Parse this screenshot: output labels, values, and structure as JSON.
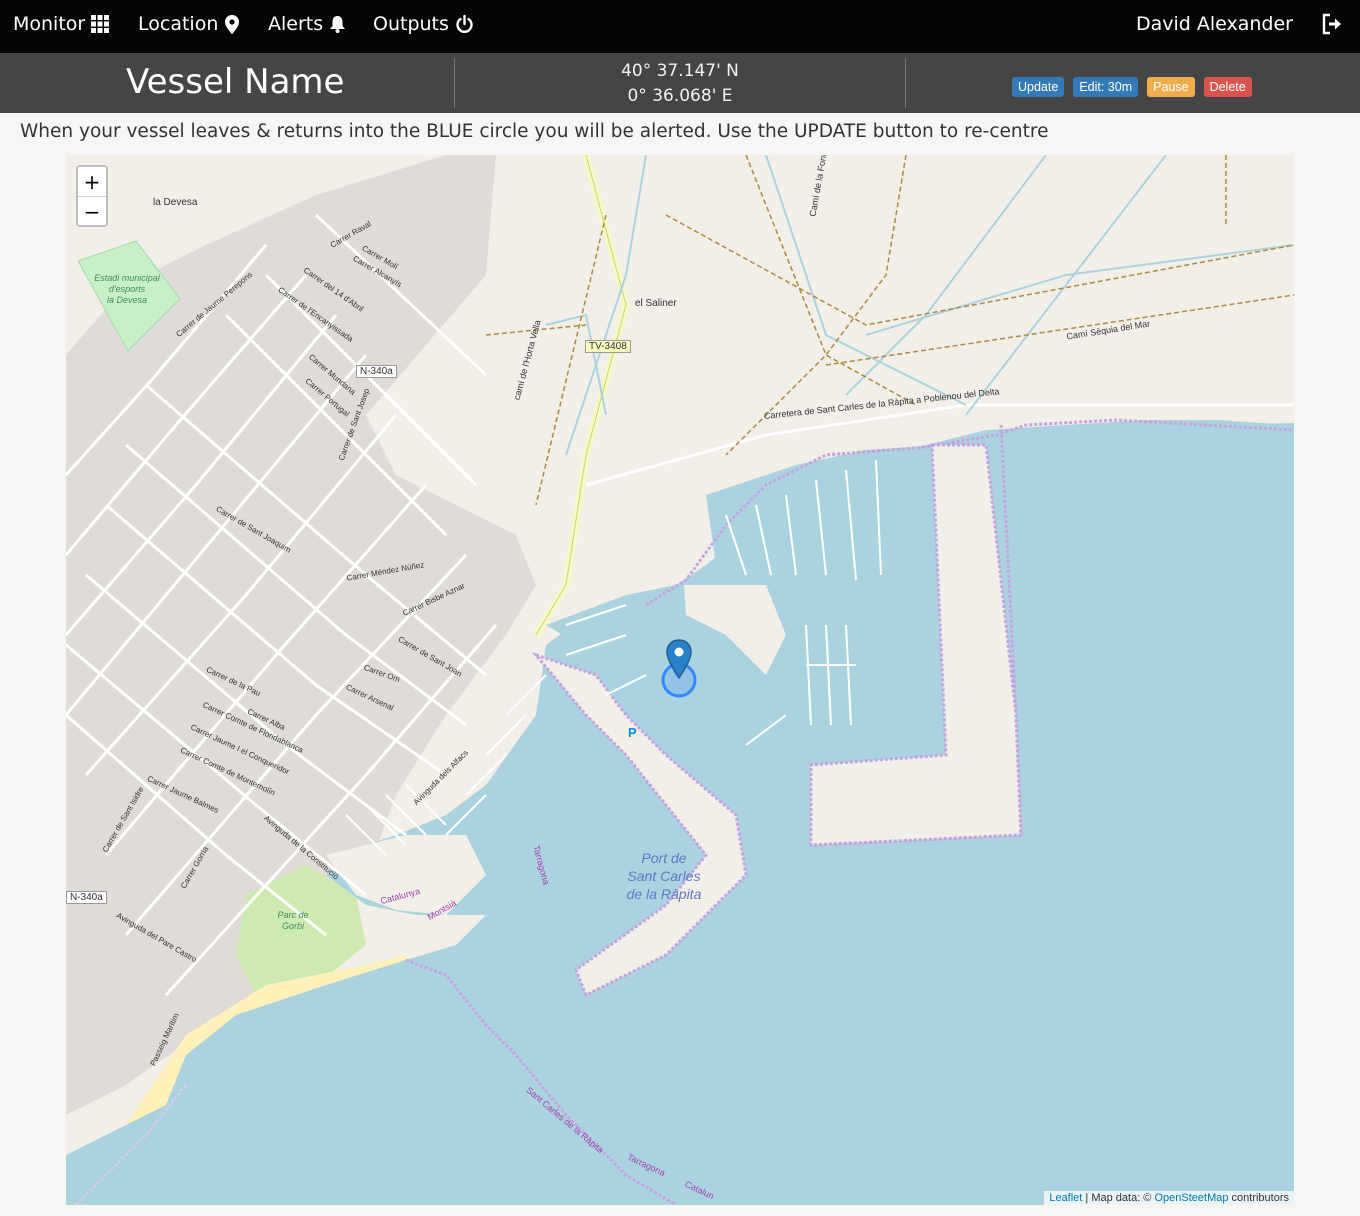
{
  "nav": {
    "monitor": "Monitor",
    "location": "Location",
    "alerts": "Alerts",
    "outputs": "Outputs",
    "user": "David Alexander",
    "logout_icon": "logout-icon"
  },
  "vessel": {
    "name": "Vessel Name",
    "lat": "40° 37.147' N",
    "lon": "0° 36.068' E"
  },
  "buttons": {
    "update": "Update",
    "edit": "Edit: 30m",
    "pause": "Pause",
    "delete": "Delete"
  },
  "colors": {
    "update": "#337ab7",
    "pause": "#f0ad4e",
    "delete": "#d9534f",
    "water": "#aad3df",
    "land": "#f2efe9"
  },
  "instructions": "When your vessel leaves & returns into the BLUE circle you will be alerted. Use the UPDATE button to re-centre",
  "map": {
    "zoom_in": "+",
    "zoom_out": "−",
    "attribution_leaflet": "Leaflet",
    "attribution_text": " | Map data: © ",
    "attribution_osm": "OpenSteetMap",
    "attribution_suffix": " contributors",
    "labels": {
      "la_devesa": "la Devesa",
      "estadi": "Estadi municipal",
      "estadi2": "d'esports",
      "estadi3": "la Devesa",
      "el_saliner": "el Saliner",
      "tv3408": "TV-3408",
      "n340a_1": "N-340a",
      "n340a_2": "N-340a",
      "cami_sequia": "Camí Sèquia del Mar",
      "carretera": "Carretera de Sant Carles de la Ràpita a Poblenou del Delta",
      "cami_font": "Camí de la Font",
      "cami_horta": "camí de l'Horta Vella",
      "port1": "Port de",
      "port2": "Sant Carles",
      "port3": "de la Ràpita",
      "parc1": "Parc de",
      "parc2": "Gorbi",
      "catalunya": "Catalunya",
      "montsia": "Montsià",
      "tarragona": "Tarragona",
      "sant_carles": "Sant Carles de la Ràpita",
      "tarragona2": "Tarragona",
      "catalunya2": "Catalun",
      "parking": "P",
      "carrer_raval": "Carrer Raval",
      "carrer_moli": "Carrer Molí",
      "carrer_alcanyis": "Carrer Alcanyís",
      "carrer_14abril": "Carrer del 14 d'Abril",
      "carrer_encanyissada": "Carrer de l'Encanyissada",
      "carrer_perepons": "Carrer de Jaume Perepons",
      "carrer_mundana": "Carrer Mundana",
      "carrer_portugal": "Carrer Portugal",
      "carrer_santjosep": "Carrer de Sant Josep",
      "carrer_santjoaquim": "Carrer de Sant Joaquim",
      "carrer_mendez": "Carrer Méndez Núñez",
      "carrer_bisbe": "Carrer Bisbe Aznar",
      "carrer_pau": "Carrer de la Pau",
      "carrer_alba": "Carrer Alba",
      "carrer_floridablanca": "Carrer Comte de Floridablanca",
      "carrer_conqueridor": "Carrer Jaume I el Conqueridor",
      "carrer_montemolin": "Carrer Comte de Montemolín",
      "carrer_balmes": "Carrer Jaume Balmes",
      "av_constitucio": "Avinguda de la Constitució",
      "av_alfacs": "Avinguda dels Alfacs",
      "av_parecastro": "Avinguda del Pare Castro",
      "passeig_maritim": "Passeig Marítim",
      "carrer_arsenal": "Carrer Arsenal",
      "carrer_om": "Carrer Om",
      "carrer_santjuan": "Carrer de Sant Joan",
      "carrer_sant_isidre": "Carrer de Sant Isidre",
      "carrer_gorria": "Carrer Gorria"
    }
  }
}
